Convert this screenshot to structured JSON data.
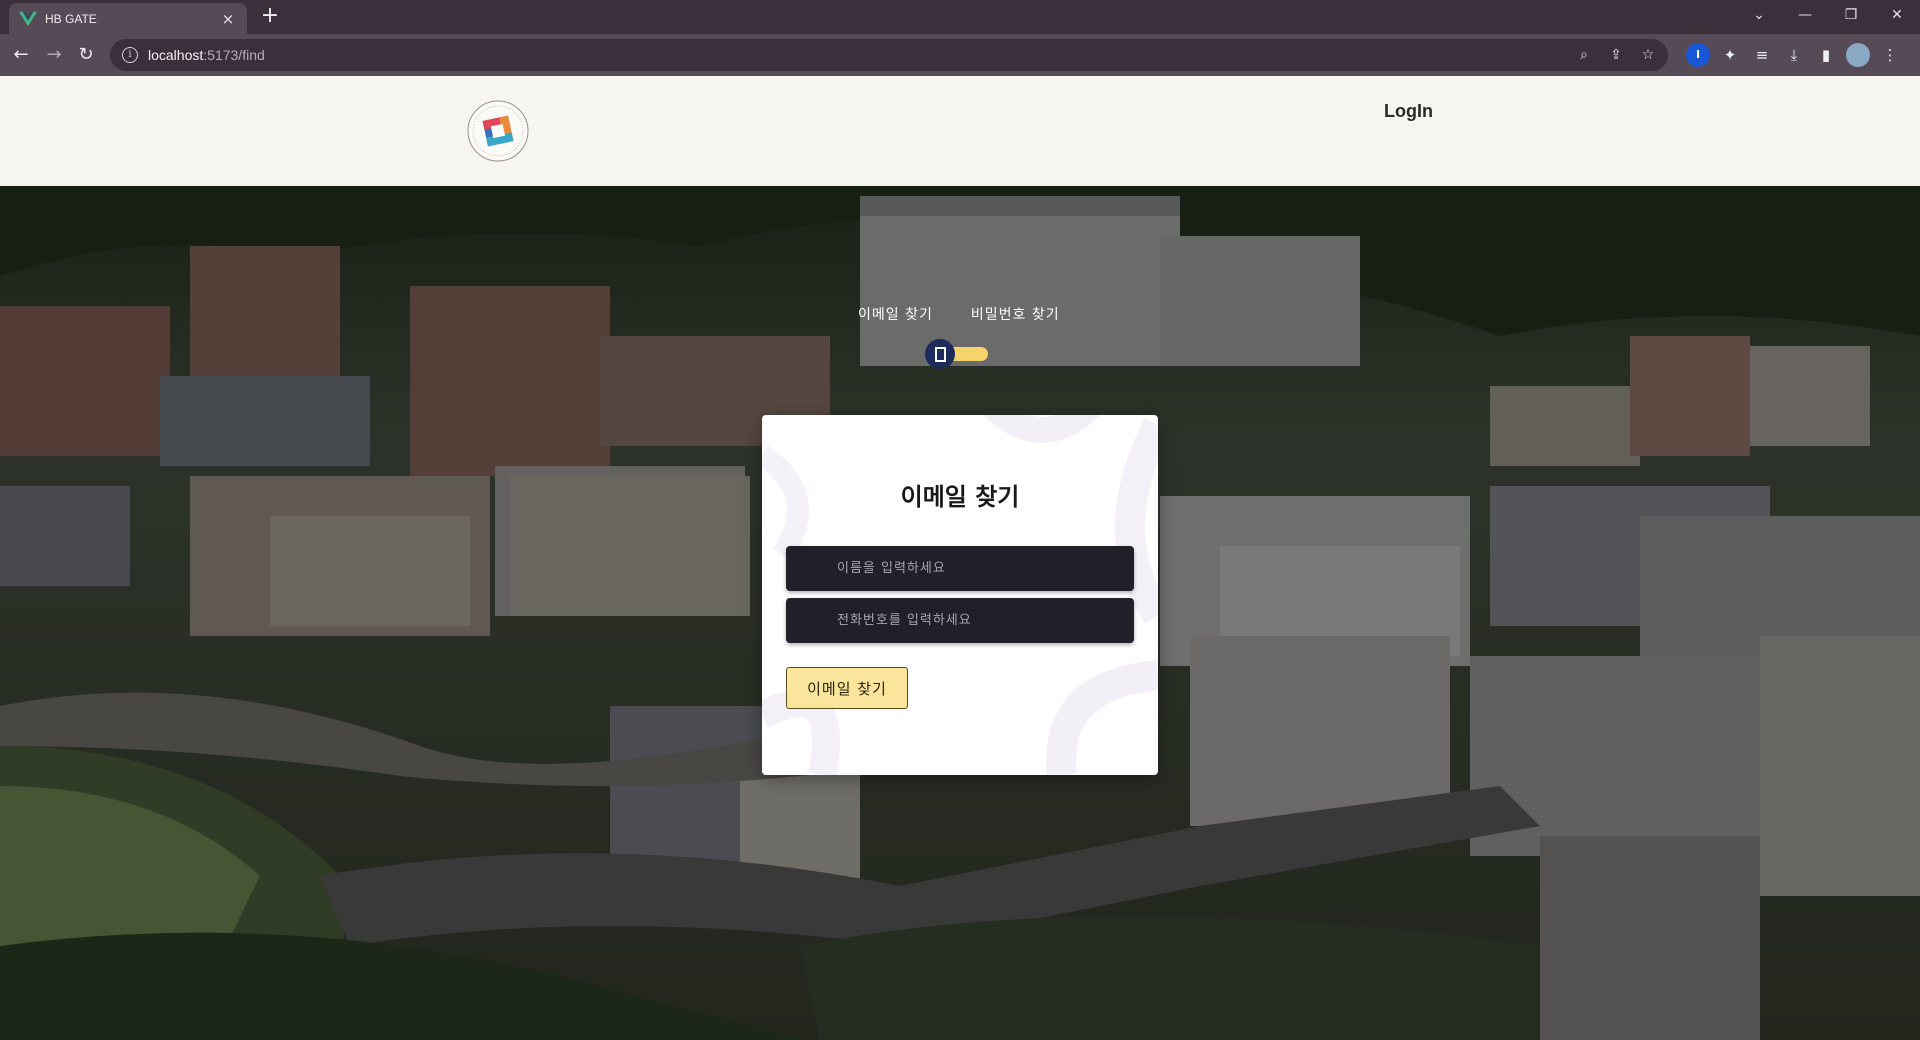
{
  "browser": {
    "tab_title": "HB GATE",
    "tab_close": "×",
    "new_tab": "+",
    "url_host": "localhost",
    "url_path": ":5173/find",
    "icons": [
      "back-icon",
      "forward-icon",
      "reload-icon",
      "info-icon",
      "zoom-icon",
      "share-icon",
      "bookmark-star-icon",
      "extension-icon",
      "media-icon",
      "download-icon",
      "sidebar-icon",
      "profile-avatar",
      "menu-icon"
    ],
    "window_controls": [
      "chevron-down-icon",
      "minimize-icon",
      "restore-icon",
      "close-icon"
    ]
  },
  "header": {
    "login_label": "LogIn"
  },
  "toggle": {
    "left_label": "이메일 찾기",
    "right_label": "비밀번호 찾기",
    "track_color": "#f6d36b",
    "knob_color": "#1d2a5c"
  },
  "card": {
    "title": "이메일 찾기",
    "name_placeholder": "이름을 입력하세요",
    "phone_placeholder": "전화번호를 입력하세요",
    "submit_label": "이메일 찾기",
    "button_color": "#fbe49b",
    "input_color": "#201f2a"
  }
}
